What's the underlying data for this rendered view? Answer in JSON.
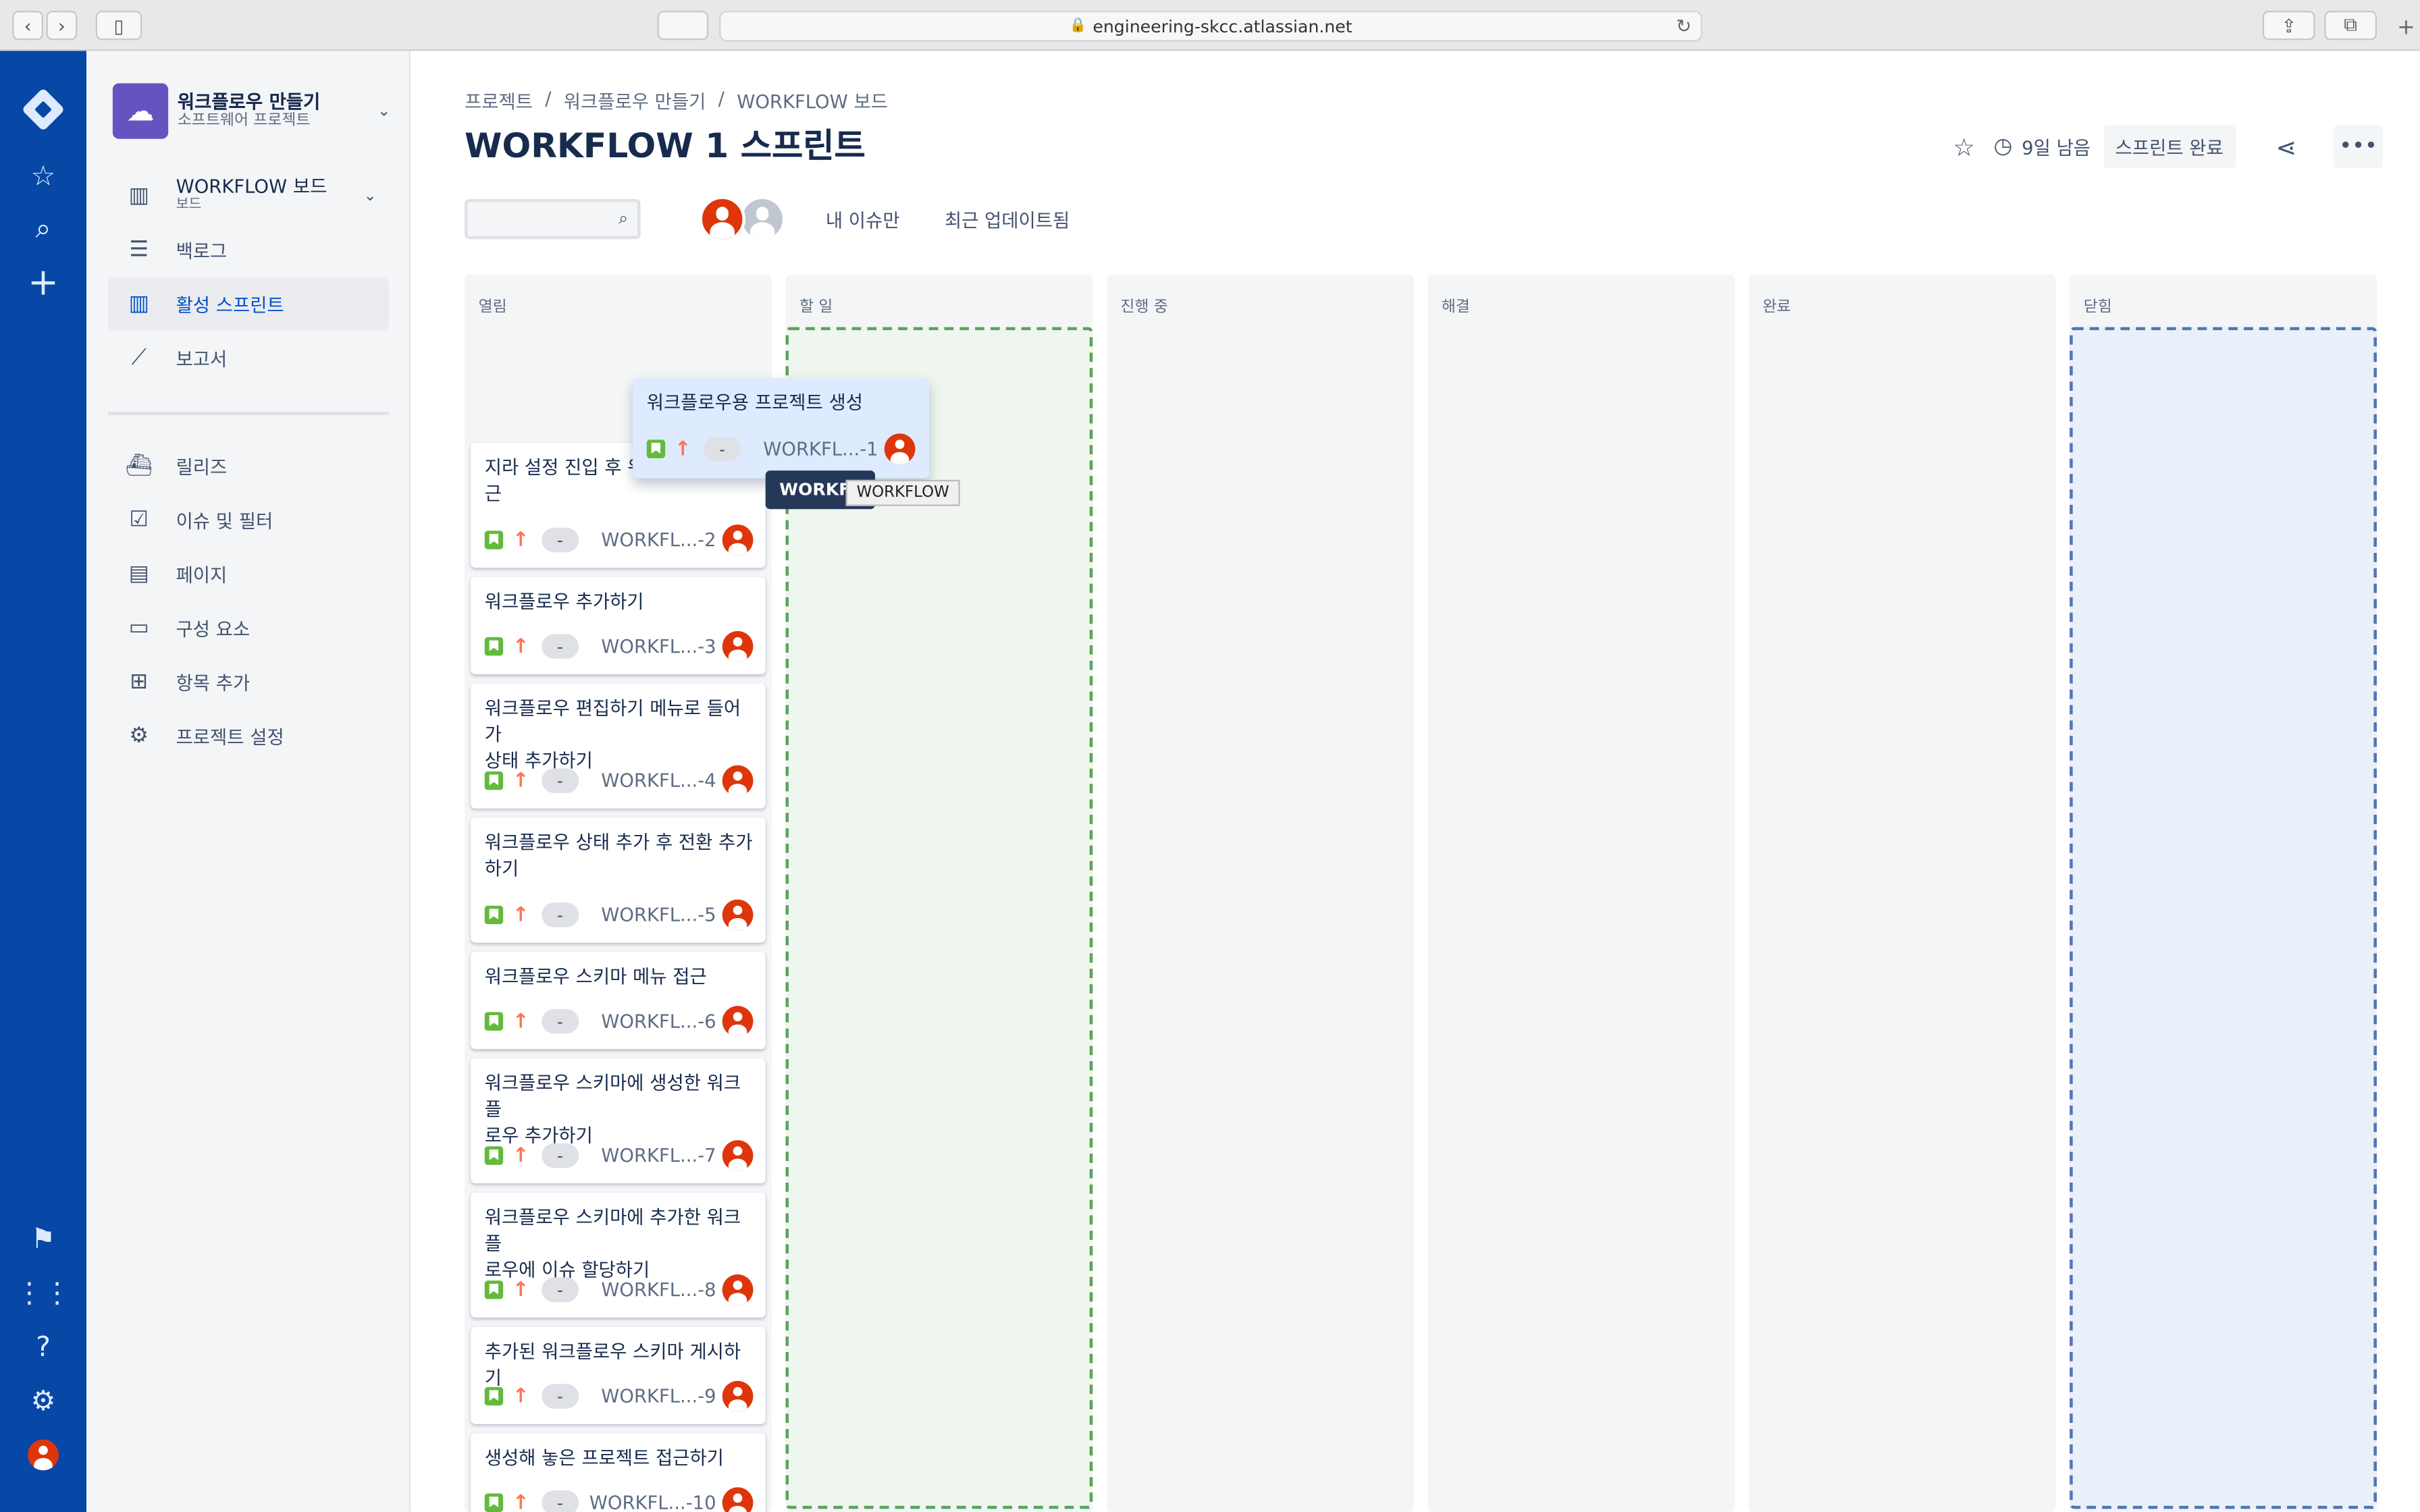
{
  "browser": {
    "url": "engineering-skcc.atlassian.net"
  },
  "sidebar": {
    "project_name": "워크플로우 만들기",
    "project_type": "소프트웨어 프로젝트",
    "board_name": "WORKFLOW 보드",
    "board_sub": "보드",
    "items": [
      {
        "label": "백로그",
        "icon": "backlog-icon"
      },
      {
        "label": "활성 스프린트",
        "icon": "board-icon"
      },
      {
        "label": "보고서",
        "icon": "reports-icon"
      },
      {
        "label": "릴리즈",
        "icon": "ship-icon"
      },
      {
        "label": "이슈 및 필터",
        "icon": "issues-icon"
      },
      {
        "label": "페이지",
        "icon": "page-icon"
      },
      {
        "label": "구성 요소",
        "icon": "components-icon"
      },
      {
        "label": "항목 추가",
        "icon": "add-item-icon"
      },
      {
        "label": "프로젝트 설정",
        "icon": "gear-icon"
      }
    ]
  },
  "header": {
    "breadcrumb": [
      "프로젝트",
      "/",
      "워크플로우 만들기",
      "/",
      "WORKFLOW 보드"
    ],
    "title": "WORKFLOW 1 스프린트",
    "days_left": "9일 남음",
    "complete_sprint": "스프린트 완료"
  },
  "filters": {
    "search_placeholder": "",
    "my_issues": "내 이슈만",
    "recently_updated": "최근 업데이트됨"
  },
  "columns": [
    "열림",
    "할 일",
    "진행 중",
    "해결",
    "완료",
    "닫힘"
  ],
  "cards": [
    {
      "summary": "지라 설정 진입 후 워",
      "summary2": "근",
      "key": "WORKFL...-2"
    },
    {
      "summary": "워크플로우 추가하기",
      "key": "WORKFL...-3"
    },
    {
      "summary": "워크플로우 편집하기 메뉴로 들어가",
      "summary2": "상태 추가하기",
      "key": "WORKFL...-4"
    },
    {
      "summary": "워크플로우 상태 추가 후 전환 추가",
      "summary2": "하기",
      "key": "WORKFL...-5"
    },
    {
      "summary": "워크플로우 스키마 메뉴 접근",
      "key": "WORKFL...-6"
    },
    {
      "summary": "워크플로우 스키마에 생성한 워크플",
      "summary2": "로우 추가하기",
      "key": "WORKFL...-7"
    },
    {
      "summary": "워크플로우 스키마에 추가한 워크플",
      "summary2": "로우에 이슈 할당하기",
      "key": "WORKFL...-8"
    },
    {
      "summary": "추가된 워크플로우 스키마 게시하기",
      "key": "WORKFL...-9"
    },
    {
      "summary": "생성해 놓은 프로젝트 접근하기",
      "key": "WORKFL...-10"
    }
  ],
  "estimate_label": "-",
  "dragging_card": {
    "summary": "워크플로우용 프로젝트 생성",
    "key": "WORKFL...-1"
  },
  "tooltips": {
    "dark": "WORKFL",
    "light": "WORKFLOW"
  },
  "colors": {
    "global_nav": "#0747a6",
    "story": "#63ba3c",
    "priority": "#ff7452",
    "avatar": "#de350b",
    "dropzone_green": "#57a55a",
    "dropzone_blue": "#4c78b5"
  }
}
